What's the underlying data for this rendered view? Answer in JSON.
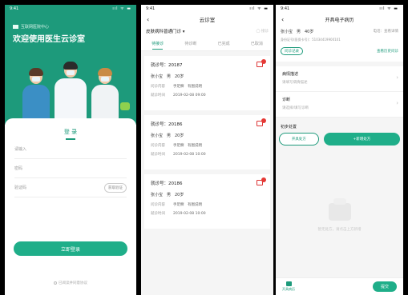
{
  "screen1": {
    "status": {
      "time": "9:41",
      "signal": "ııl ᯤ ▬"
    },
    "brand": "互联网医院中心",
    "welcome": "欢迎使用医生云诊室",
    "login_title": "登 录",
    "phone_placeholder": "请输入",
    "password_placeholder": "密码",
    "code_placeholder": "验证码",
    "code_button": "获取验证",
    "login_button": "立即登录",
    "agreement": "已阅读并同意协议"
  },
  "screen2": {
    "status": {
      "time": "9:41",
      "signal": "ııl ᯤ ▬"
    },
    "title": "云诊室",
    "dept": "皮肤病科普通门诊 ▾",
    "toggle": "◯ 接诊",
    "tabs": [
      "待接诊",
      "待诊断",
      "已完成",
      "已取消"
    ],
    "cards": [
      {
        "no": "就诊号：20187",
        "patient": "张小宝　男　20岁",
        "r1_label": "问诊内容",
        "r1_value": "手足癣　有图说明",
        "r2_label": "就诊时间",
        "r2_value": "2019-02-08 09:00"
      },
      {
        "no": "就诊号：20186",
        "patient": "张小宝　男　20岁",
        "r1_label": "问诊内容",
        "r1_value": "手足癣　有图说明",
        "r2_label": "就诊时间",
        "r2_value": "2019-02-08 10:00"
      },
      {
        "no": "就诊号：20186",
        "patient": "张小宝　男　20岁",
        "r1_label": "问诊内容",
        "r1_value": "手足癣　有图说明",
        "r2_label": "就诊时间",
        "r2_value": "2019-02-08 10:00"
      }
    ]
  },
  "screen3": {
    "status": {
      "time": "9:41",
      "signal": "ııl ᯤ ▬"
    },
    "title": "开具电子病历",
    "patient_name": "张小宝　男　40岁",
    "patient_right": "电话：查看详情",
    "patient_id": "身份证号(医保卡号)：51034419900101",
    "tag": "问诊记录",
    "link": "查看历史问诊",
    "items": [
      {
        "title": "病情描述",
        "sub": "请填写病情描述"
      },
      {
        "title": "诊断",
        "sub": "请选择/填写诊断"
      }
    ],
    "dx_label": "初步处置",
    "btn_outline": "开具处方",
    "btn_fill": "+新增处方",
    "empty": "暂无处方，请点击上方新增",
    "tab_home": "开具病历",
    "submit": "提交"
  },
  "colors": {
    "primary": "#1d9a7b",
    "button": "#1fae89",
    "badge": "#e53935"
  }
}
